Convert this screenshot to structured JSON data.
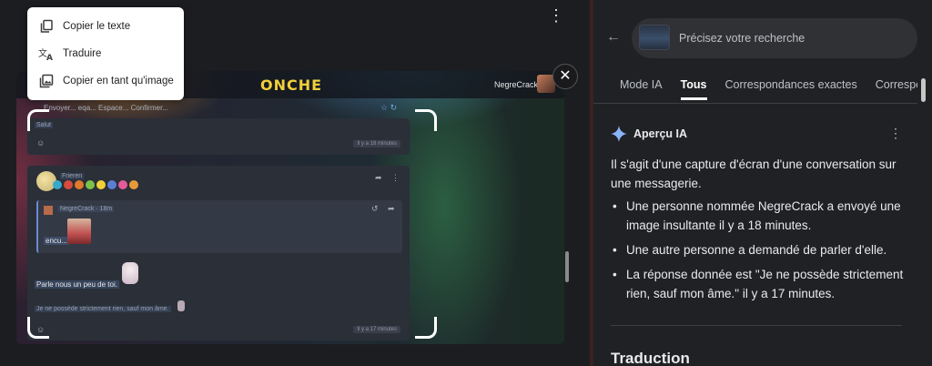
{
  "context_menu": {
    "items": [
      {
        "label": "Copier le texte",
        "icon": "copy-icon"
      },
      {
        "label": "Traduire",
        "icon": "translate-icon"
      },
      {
        "label": "Copier en tant qu'image",
        "icon": "image-icon"
      }
    ]
  },
  "screenshot": {
    "logo": "ONCHE",
    "username": "NegreCrack",
    "breadcrumb": "Envoyer... eqa... Espace... Confirmer...",
    "msg1_text": "Salut",
    "msg1_time": "Il y a 18 minutes",
    "msg2_author": "Frieren",
    "reply_author": "NegreCrack · 18m",
    "reply_text": "encu...",
    "msg2_text": "Parle nous un peu de toi.",
    "msg3_text": "Je ne possède strictement rien, sauf mon âme.",
    "msg3_time": "Il y a 17 minutes"
  },
  "search": {
    "placeholder": "Précisez votre recherche"
  },
  "tabs": [
    {
      "label": "Mode IA",
      "active": false
    },
    {
      "label": "Tous",
      "active": true
    },
    {
      "label": "Correspondances exactes",
      "active": false
    },
    {
      "label": "Correspo",
      "active": false
    }
  ],
  "ai_overview": {
    "title": "Aperçu IA",
    "intro": "Il s'agit d'une capture d'écran d'une conversation sur une messagerie.",
    "bullets": [
      "Une personne nommée NegreCrack a envoyé une image insultante il y a 18 minutes.",
      "Une autre personne a demandé de parler d'elle.",
      "La réponse donnée est \"Je ne possède strictement rien, sauf mon âme.\" il y a 17 minutes."
    ]
  },
  "next_section_title": "Traduction",
  "colors": {
    "panel_bg": "#202124",
    "accent_spark": "#8ab4f8",
    "frame": "#3a2220"
  }
}
